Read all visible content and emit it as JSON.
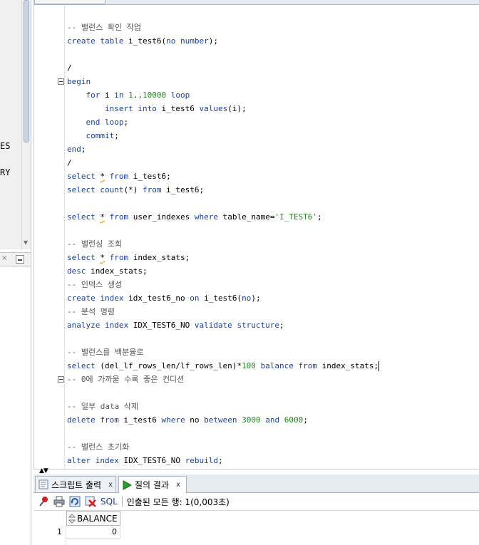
{
  "left_panel": {
    "label_es": "ES",
    "label_ry": "RY",
    "close_glyph": "×"
  },
  "editor": {
    "lines": [
      {
        "parts": [
          {
            "t": "-- 밸런스 확인 작업",
            "c": "cm"
          }
        ]
      },
      {
        "parts": [
          {
            "t": "create",
            "c": "kw"
          },
          {
            "t": " "
          },
          {
            "t": "table",
            "c": "kw"
          },
          {
            "t": " i_test6("
          },
          {
            "t": "no",
            "c": "kw"
          },
          {
            "t": " "
          },
          {
            "t": "number",
            "c": "kw"
          },
          {
            "t": ");"
          }
        ]
      },
      {
        "parts": []
      },
      {
        "parts": [
          {
            "t": "/"
          }
        ]
      },
      {
        "fold": true,
        "parts": [
          {
            "t": "begin",
            "c": "kw"
          }
        ]
      },
      {
        "parts": [
          {
            "t": "    "
          },
          {
            "t": "for",
            "c": "kw"
          },
          {
            "t": " i "
          },
          {
            "t": "in",
            "c": "kw"
          },
          {
            "t": " "
          },
          {
            "t": "1",
            "c": "num"
          },
          {
            "t": ".."
          },
          {
            "t": "10000",
            "c": "num"
          },
          {
            "t": " "
          },
          {
            "t": "loop",
            "c": "kw"
          }
        ]
      },
      {
        "parts": [
          {
            "t": "        "
          },
          {
            "t": "insert",
            "c": "kw"
          },
          {
            "t": " "
          },
          {
            "t": "into",
            "c": "kw"
          },
          {
            "t": " i_test6 "
          },
          {
            "t": "values",
            "c": "kw"
          },
          {
            "t": "(i);"
          }
        ]
      },
      {
        "parts": [
          {
            "t": "    "
          },
          {
            "t": "end",
            "c": "kw"
          },
          {
            "t": " "
          },
          {
            "t": "loop",
            "c": "kw"
          },
          {
            "t": ";"
          }
        ]
      },
      {
        "parts": [
          {
            "t": "    "
          },
          {
            "t": "commit",
            "c": "kw"
          },
          {
            "t": ";"
          }
        ]
      },
      {
        "parts": [
          {
            "t": "end",
            "c": "kw"
          },
          {
            "t": ";"
          }
        ]
      },
      {
        "parts": [
          {
            "t": "/"
          }
        ]
      },
      {
        "parts": [
          {
            "t": "select",
            "c": "kw"
          },
          {
            "t": " "
          },
          {
            "t": "*",
            "c": "star"
          },
          {
            "t": " "
          },
          {
            "t": "from",
            "c": "kw"
          },
          {
            "t": " i_test6;"
          }
        ]
      },
      {
        "parts": [
          {
            "t": "select",
            "c": "kw"
          },
          {
            "t": " "
          },
          {
            "t": "count",
            "c": "kw"
          },
          {
            "t": "(*) "
          },
          {
            "t": "from",
            "c": "kw"
          },
          {
            "t": " i_test6;"
          }
        ]
      },
      {
        "parts": []
      },
      {
        "parts": [
          {
            "t": "select",
            "c": "kw"
          },
          {
            "t": " "
          },
          {
            "t": "*",
            "c": "star"
          },
          {
            "t": " "
          },
          {
            "t": "from",
            "c": "kw"
          },
          {
            "t": " user_indexes "
          },
          {
            "t": "where",
            "c": "kw"
          },
          {
            "t": " table_name="
          },
          {
            "t": "'I_TEST6'",
            "c": "str"
          },
          {
            "t": ";"
          }
        ]
      },
      {
        "parts": []
      },
      {
        "parts": [
          {
            "t": "-- 밸런싱 조회",
            "c": "cm"
          }
        ]
      },
      {
        "parts": [
          {
            "t": "select",
            "c": "kw"
          },
          {
            "t": " "
          },
          {
            "t": "*",
            "c": "star"
          },
          {
            "t": " "
          },
          {
            "t": "from",
            "c": "kw"
          },
          {
            "t": " index_stats;"
          }
        ]
      },
      {
        "parts": [
          {
            "t": "desc",
            "c": "kw"
          },
          {
            "t": " index_stats;"
          }
        ]
      },
      {
        "parts": [
          {
            "t": "-- 인덱스 생성",
            "c": "cm"
          }
        ]
      },
      {
        "parts": [
          {
            "t": "create",
            "c": "kw"
          },
          {
            "t": " "
          },
          {
            "t": "index",
            "c": "kw"
          },
          {
            "t": " idx_test6_no "
          },
          {
            "t": "on",
            "c": "kw"
          },
          {
            "t": " i_test6("
          },
          {
            "t": "no",
            "c": "kw"
          },
          {
            "t": ");"
          }
        ]
      },
      {
        "parts": [
          {
            "t": "-- 분석 명령",
            "c": "cm"
          }
        ]
      },
      {
        "parts": [
          {
            "t": "analyze",
            "c": "kw"
          },
          {
            "t": " "
          },
          {
            "t": "index",
            "c": "kw"
          },
          {
            "t": " IDX_TEST6_NO "
          },
          {
            "t": "validate",
            "c": "kw"
          },
          {
            "t": " "
          },
          {
            "t": "structure",
            "c": "kw"
          },
          {
            "t": ";"
          }
        ]
      },
      {
        "parts": []
      },
      {
        "parts": [
          {
            "t": "-- 밸런스를 백분율로",
            "c": "cm"
          }
        ]
      },
      {
        "caret": true,
        "parts": [
          {
            "t": "select",
            "c": "kw"
          },
          {
            "t": " (del_lf_rows_len/lf_rows_len)*"
          },
          {
            "t": "100",
            "c": "num"
          },
          {
            "t": " "
          },
          {
            "t": "balance",
            "c": "kw"
          },
          {
            "t": " "
          },
          {
            "t": "from",
            "c": "kw"
          },
          {
            "t": " index_stats;"
          }
        ]
      },
      {
        "fold": true,
        "parts": [
          {
            "t": "-- 0에 가까울 수록 좋은 컨디션",
            "c": "cm"
          }
        ]
      },
      {
        "parts": []
      },
      {
        "parts": [
          {
            "t": "-- 일부 data 삭제",
            "c": "cm"
          }
        ]
      },
      {
        "parts": [
          {
            "t": "delete",
            "c": "kw"
          },
          {
            "t": " "
          },
          {
            "t": "from",
            "c": "kw"
          },
          {
            "t": " i_test6 "
          },
          {
            "t": "where",
            "c": "kw"
          },
          {
            "t": " no "
          },
          {
            "t": "between",
            "c": "kw"
          },
          {
            "t": " "
          },
          {
            "t": "3000",
            "c": "num"
          },
          {
            "t": " "
          },
          {
            "t": "and",
            "c": "kw"
          },
          {
            "t": " "
          },
          {
            "t": "6000",
            "c": "num"
          },
          {
            "t": ";"
          }
        ]
      },
      {
        "parts": []
      },
      {
        "parts": [
          {
            "t": "-- 밸런스 초기화",
            "c": "cm"
          }
        ]
      },
      {
        "parts": [
          {
            "t": "alter",
            "c": "kw"
          },
          {
            "t": " "
          },
          {
            "t": "index",
            "c": "kw"
          },
          {
            "t": " IDX_TEST6_NO "
          },
          {
            "t": "rebuild",
            "c": "kw"
          },
          {
            "t": ";"
          }
        ]
      }
    ]
  },
  "bottom": {
    "tab_script_output": "스크립트 출력",
    "tab_query_result": "질의 결과",
    "tab_close": "x",
    "toolbar_sql": "SQL",
    "toolbar_status": "인출된 모든 행: 1(0,003초)",
    "grid": {
      "columns": [
        "BALANCE"
      ],
      "rows": [
        {
          "num": "1",
          "values": [
            "0"
          ]
        }
      ]
    }
  },
  "colors": {
    "keyword": "#1b3f9e",
    "comment": "#555555",
    "number": "#208a20",
    "string": "#208a20"
  },
  "icons": [
    "pin-icon",
    "print-icon",
    "refresh-icon",
    "delete-icon",
    "run-icon",
    "script-icon",
    "sort-icon"
  ]
}
